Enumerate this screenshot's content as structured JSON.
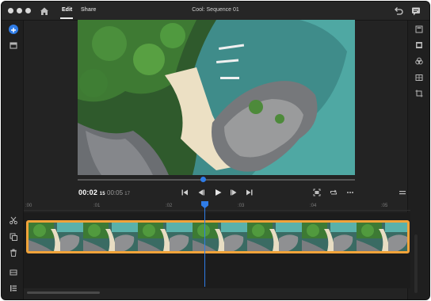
{
  "titlebar": {
    "tabs": [
      {
        "label": "Edit",
        "active": true
      },
      {
        "label": "Share",
        "active": false
      }
    ],
    "sequence_title": "Cool: Sequence 01",
    "icons": [
      "home-icon",
      "undo-icon",
      "comment-icon"
    ]
  },
  "left_rail": {
    "icons": [
      "add-media-icon",
      "project-panel-icon",
      "split-scissors-icon",
      "duplicate-icon",
      "trash-icon",
      "track-height-icon",
      "track-options-icon"
    ]
  },
  "right_rail": {
    "icons": [
      "title-panel-icon",
      "filmstrip-icon",
      "color-icon",
      "audio-icon",
      "transform-icon"
    ]
  },
  "viewer": {
    "current_time": "00:02",
    "current_frames": "15",
    "total_time": "00:05",
    "total_frames": "17",
    "playback_progress": 0.445,
    "controls": [
      "go-to-start-icon",
      "step-back-icon",
      "play-icon",
      "step-forward-icon",
      "go-to-end-icon"
    ],
    "right_controls": [
      "fit-frame-icon",
      "loop-icon",
      "more-options-icon"
    ],
    "menu_icon": "hamburger-menu-icon"
  },
  "timeline": {
    "ruler_labels": [
      ":00",
      ":01",
      ":02",
      ":03",
      ":04",
      ":05"
    ],
    "playhead_position": 0.47,
    "clip_color": "#f0a33a",
    "thumbnail_count": 7
  },
  "colors": {
    "accent": "#2f7ce6",
    "background": "#232323",
    "clip_border": "#f0a33a"
  }
}
